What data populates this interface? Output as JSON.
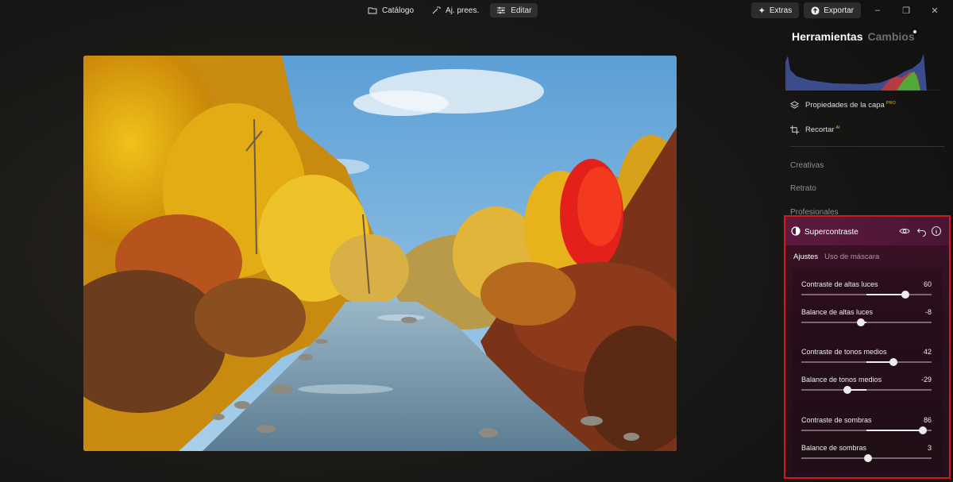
{
  "topbar": {
    "catalog_label": "Catálogo",
    "presets_label": "Aj. prees.",
    "edit_label": "Editar",
    "extras_label": "Extras",
    "export_label": "Exportar"
  },
  "panel": {
    "tab_tools": "Herramientas",
    "tab_changes": "Cambios",
    "layer_properties": "Propiedades de la capa",
    "layer_properties_badge": "PRO",
    "crop": "Recortar",
    "crop_badge": "AI",
    "categories": [
      "Creativas",
      "Retrato",
      "Profesionales"
    ]
  },
  "supercontrast": {
    "title": "Supercontraste",
    "tab_adjust": "Ajustes",
    "tab_mask": "Uso de máscara",
    "sliders": [
      {
        "label": "Contraste de altas luces",
        "value": 60,
        "min": -100,
        "max": 100
      },
      {
        "label": "Balance de altas luces",
        "value": -8,
        "min": -100,
        "max": 100
      },
      {
        "label": "Contraste de tonos medios",
        "value": 42,
        "min": -100,
        "max": 100
      },
      {
        "label": "Balance de tonos medios",
        "value": -29,
        "min": -100,
        "max": 100
      },
      {
        "label": "Contraste de sombras",
        "value": 86,
        "min": -100,
        "max": 100
      },
      {
        "label": "Balance de sombras",
        "value": 3,
        "min": -100,
        "max": 100
      }
    ]
  },
  "colors": {
    "accent_border": "#d11a1a",
    "panel_header": "#5c1a3f"
  },
  "icons": [
    "folder-icon",
    "magic-wand-icon",
    "sliders-icon",
    "sparkle-icon",
    "export-icon",
    "minimize-icon",
    "restore-icon",
    "close-icon",
    "layers-icon",
    "crop-icon",
    "contrast-icon",
    "eye-icon",
    "undo-icon",
    "info-icon"
  ]
}
